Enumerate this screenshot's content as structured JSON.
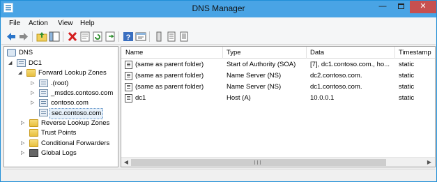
{
  "window": {
    "title": "DNS Manager"
  },
  "menu": [
    "File",
    "Action",
    "View",
    "Help"
  ],
  "toolbar": [
    "back-icon",
    "forward-icon",
    "up-folder-icon",
    "show-hide-tree-icon",
    "delete-icon",
    "properties-icon",
    "refresh-icon",
    "export-list-icon",
    "help-icon",
    "console-icon",
    "server-view-icon",
    "list-view-icon",
    "detail-view-icon"
  ],
  "tree": {
    "root": "DNS",
    "server": "DC1",
    "forward_zones": "Forward Lookup Zones",
    "zones": [
      ".(root)",
      "_msdcs.contoso.com",
      "contoso.com",
      "sec.contoso.com"
    ],
    "reverse_zones": "Reverse Lookup Zones",
    "trust_points": "Trust Points",
    "conditional_forwarders": "Conditional Forwarders",
    "global_logs": "Global Logs"
  },
  "list": {
    "columns": [
      "Name",
      "Type",
      "Data",
      "Timestamp"
    ],
    "rows": [
      {
        "name": "(same as parent folder)",
        "type": "Start of Authority (SOA)",
        "data": "[7], dc1.contoso.com., ho...",
        "timestamp": "static"
      },
      {
        "name": "(same as parent folder)",
        "type": "Name Server (NS)",
        "data": "dc2.contoso.com.",
        "timestamp": "static"
      },
      {
        "name": "(same as parent folder)",
        "type": "Name Server (NS)",
        "data": "dc1.contoso.com.",
        "timestamp": "static"
      },
      {
        "name": "dc1",
        "type": "Host (A)",
        "data": "10.0.0.1",
        "timestamp": "static"
      }
    ]
  },
  "colors": {
    "titlebar": "#49a4e5",
    "close_button": "#c75050"
  }
}
